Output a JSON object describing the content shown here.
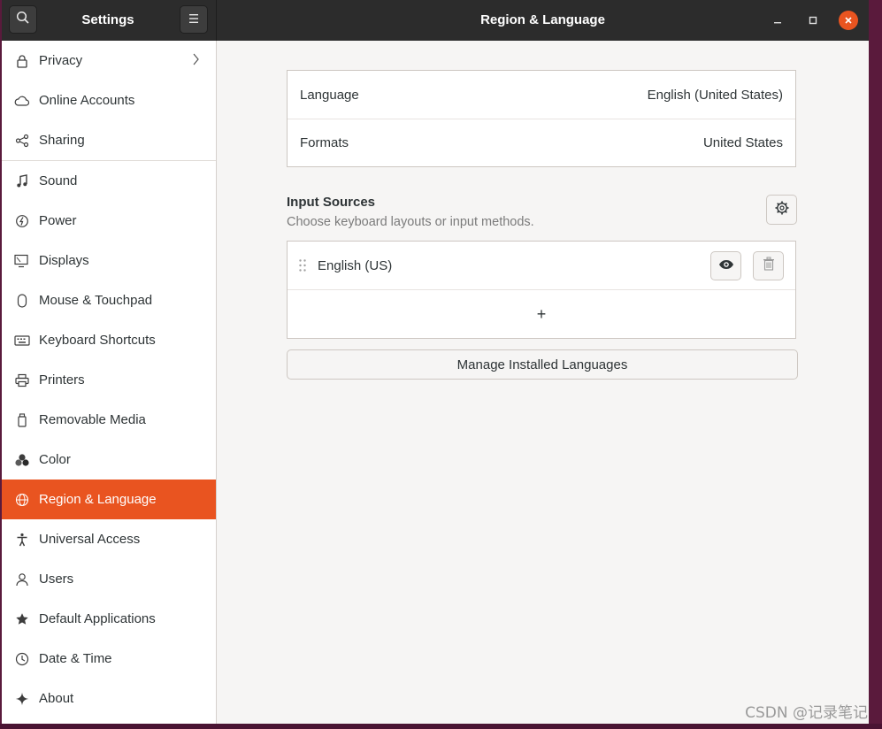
{
  "header": {
    "app_title": "Settings",
    "page_title": "Region & Language",
    "icons": {
      "search": "search-icon",
      "menu": "hamburger-menu-icon",
      "minimize": "minimize-icon",
      "maximize": "maximize-icon",
      "close": "close-icon"
    }
  },
  "colors": {
    "accent": "#e95420",
    "headerbar": "#2c2c2c",
    "background": "#f6f5f4"
  },
  "sidebar": {
    "items": [
      {
        "label": "Privacy",
        "icon": "lock-icon",
        "chevron": true
      },
      {
        "label": "Online Accounts",
        "icon": "cloud-icon"
      },
      {
        "label": "Sharing",
        "icon": "share-icon"
      },
      {
        "label": "Sound",
        "icon": "music-note-icon"
      },
      {
        "label": "Power",
        "icon": "power-icon"
      },
      {
        "label": "Displays",
        "icon": "display-icon"
      },
      {
        "label": "Mouse & Touchpad",
        "icon": "mouse-icon"
      },
      {
        "label": "Keyboard Shortcuts",
        "icon": "keyboard-icon"
      },
      {
        "label": "Printers",
        "icon": "printer-icon"
      },
      {
        "label": "Removable Media",
        "icon": "usb-drive-icon"
      },
      {
        "label": "Color",
        "icon": "color-icon"
      },
      {
        "label": "Region & Language",
        "icon": "globe-icon",
        "active": true
      },
      {
        "label": "Universal Access",
        "icon": "accessibility-icon"
      },
      {
        "label": "Users",
        "icon": "user-icon"
      },
      {
        "label": "Default Applications",
        "icon": "star-icon"
      },
      {
        "label": "Date & Time",
        "icon": "clock-icon"
      },
      {
        "label": "About",
        "icon": "sparkle-icon"
      }
    ]
  },
  "main": {
    "language": {
      "label": "Language",
      "value": "English (United States)"
    },
    "formats": {
      "label": "Formats",
      "value": "United States"
    },
    "input_sources": {
      "title": "Input Sources",
      "subtitle": "Choose keyboard layouts or input methods.",
      "sources": [
        {
          "label": "English (US)"
        }
      ],
      "add_symbol": "+"
    },
    "manage_button": "Manage Installed Languages"
  },
  "watermark": "CSDN @记录笔记"
}
